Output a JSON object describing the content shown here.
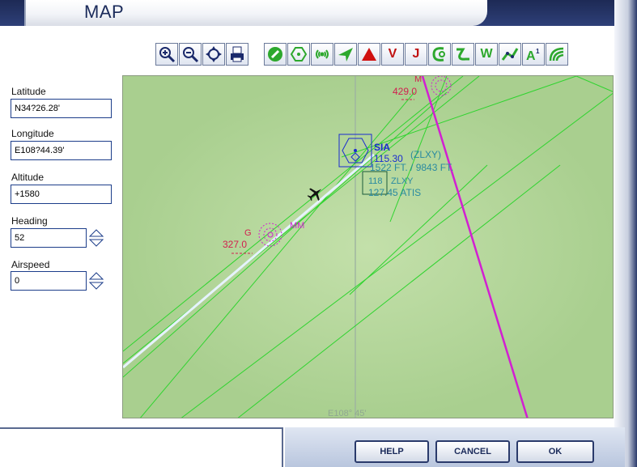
{
  "window": {
    "title": "MAP"
  },
  "toolbar": {
    "view_buttons": [
      {
        "name": "zoom-in-icon"
      },
      {
        "name": "zoom-out-icon"
      },
      {
        "name": "center-aircraft-icon"
      },
      {
        "name": "print-icon"
      }
    ],
    "filter_buttons": [
      {
        "name": "airports-icon"
      },
      {
        "name": "vor-icon"
      },
      {
        "name": "ndb-icon"
      },
      {
        "name": "intersections-icon"
      },
      {
        "name": "markers-icon"
      },
      {
        "name": "victor-airways-label",
        "text": "V"
      },
      {
        "name": "jet-airways-label",
        "text": "J"
      },
      {
        "name": "approaches-icon"
      },
      {
        "name": "ils-icon"
      },
      {
        "name": "waypoints-label",
        "text": "W"
      },
      {
        "name": "hl-airways-icon"
      },
      {
        "name": "altitude-icon"
      },
      {
        "name": "terrain-icon"
      }
    ]
  },
  "fields": {
    "latitude": {
      "label": "Latitude",
      "value": "N34?26.28'"
    },
    "longitude": {
      "label": "Longitude",
      "value": "E108?44.39'"
    },
    "altitude": {
      "label": "Altitude",
      "value": "+1580"
    },
    "heading": {
      "label": "Heading",
      "value": "52"
    },
    "airspeed": {
      "label": "Airspeed",
      "value": "0"
    }
  },
  "map": {
    "ndb_top": {
      "freq": "429.0",
      "ident": "M"
    },
    "ndb_left": {
      "freq": "327.0",
      "ident": "G",
      "marker": "MM"
    },
    "vor": {
      "ident": "SIA",
      "freq": "115.30"
    },
    "airport": {
      "name": "(ZLXY)",
      "elev": "1522 FT. / 9843 FT.",
      "ils_freq": "118",
      "ils_ident": "ZLXY",
      "atis": "127.45 ATIS"
    },
    "longitude_label": "E108° 45'",
    "colors": {
      "ground": "#b5d79d",
      "airway": "#2fd42f",
      "magenta": "#d21fd2",
      "runway": "#e8f4ff",
      "vor": "#1a2bd0"
    }
  },
  "buttons": {
    "help": "HELP",
    "cancel": "CANCEL",
    "ok": "OK"
  }
}
